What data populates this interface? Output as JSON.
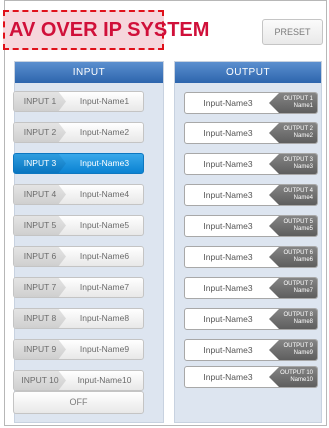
{
  "header": {
    "title": "AV OVER IP SYSTEM",
    "preset_label": "PRESET"
  },
  "input_panel": {
    "title": "INPUT",
    "selected": 2,
    "items": [
      {
        "num": "INPUT 1",
        "name": "Input-Name1"
      },
      {
        "num": "INPUT 2",
        "name": "Input-Name2"
      },
      {
        "num": "INPUT 3",
        "name": "Input-Name3"
      },
      {
        "num": "INPUT 4",
        "name": "Input-Name4"
      },
      {
        "num": "INPUT 5",
        "name": "Input-Name5"
      },
      {
        "num": "INPUT 6",
        "name": "Input-Name6"
      },
      {
        "num": "INPUT 7",
        "name": "Input-Name7"
      },
      {
        "num": "INPUT 8",
        "name": "Input-Name8"
      },
      {
        "num": "INPUT 9",
        "name": "Input-Name9"
      },
      {
        "num": "INPUT 10",
        "name": "Input-Name10"
      }
    ],
    "off_label": "OFF"
  },
  "output_panel": {
    "title": "OUTPUT",
    "items": [
      {
        "source": "Input-Name3",
        "out": "OUTPUT 1",
        "name": "Name1"
      },
      {
        "source": "Input-Name3",
        "out": "OUTPUT 2",
        "name": "Name2"
      },
      {
        "source": "Input-Name3",
        "out": "OUTPUT 3",
        "name": "Name3"
      },
      {
        "source": "Input-Name3",
        "out": "OUTPUT 4",
        "name": "Name4"
      },
      {
        "source": "Input-Name3",
        "out": "OUTPUT 5",
        "name": "Name5"
      },
      {
        "source": "Input-Name3",
        "out": "OUTPUT 6",
        "name": "Name6"
      },
      {
        "source": "Input-Name3",
        "out": "OUTPUT 7",
        "name": "Name7"
      },
      {
        "source": "Input-Name3",
        "out": "OUTPUT 8",
        "name": "Name8"
      },
      {
        "source": "Input-Name3",
        "out": "OUTPUT 9",
        "name": "Name9"
      },
      {
        "source": "Input-Name3",
        "out": "OUTPUT 10",
        "name": "Name10"
      }
    ]
  },
  "colors": {
    "accent": "#0a82d2",
    "header_blue": "#2d65ad",
    "title_red": "#d0103a"
  }
}
